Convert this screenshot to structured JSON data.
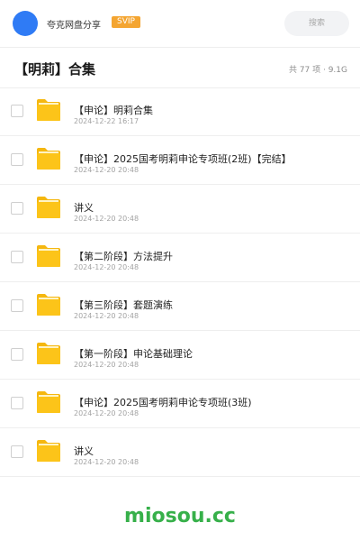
{
  "header": {
    "app_name": "夸克网盘分享",
    "badge": "SVIP",
    "search_placeholder": "搜索"
  },
  "folder": {
    "title": "【明莉】合集",
    "summary": "共 77 项 · 9.1G"
  },
  "items": [
    {
      "name": "【申论】明莉合集",
      "date": "2024-12-22 16:17",
      "icon": "folder-icon"
    },
    {
      "name": "【申论】2025国考明莉申论专项班(2班)【完结】",
      "date": "2024-12-20 20:48",
      "icon": "folder-icon"
    },
    {
      "name": "讲义",
      "date": "2024-12-20 20:48",
      "icon": "folder-icon"
    },
    {
      "name": "【第二阶段】方法提升",
      "date": "2024-12-20 20:48",
      "icon": "folder-icon"
    },
    {
      "name": "【第三阶段】套题演练",
      "date": "2024-12-20 20:48",
      "icon": "folder-icon"
    },
    {
      "name": "【第一阶段】申论基础理论",
      "date": "2024-12-20 20:48",
      "icon": "folder-icon"
    },
    {
      "name": "【申论】2025国考明莉申论专项班(3班)",
      "date": "2024-12-20 20:48",
      "icon": "folder-icon"
    },
    {
      "name": "讲义",
      "date": "2024-12-20 20:48",
      "icon": "folder-icon"
    }
  ],
  "watermark": "miosou.cc",
  "colors": {
    "accent": "#2f7bf5",
    "svip_badge": "#f4a531",
    "folder": "#fcc419",
    "watermark": "#37b04a"
  }
}
